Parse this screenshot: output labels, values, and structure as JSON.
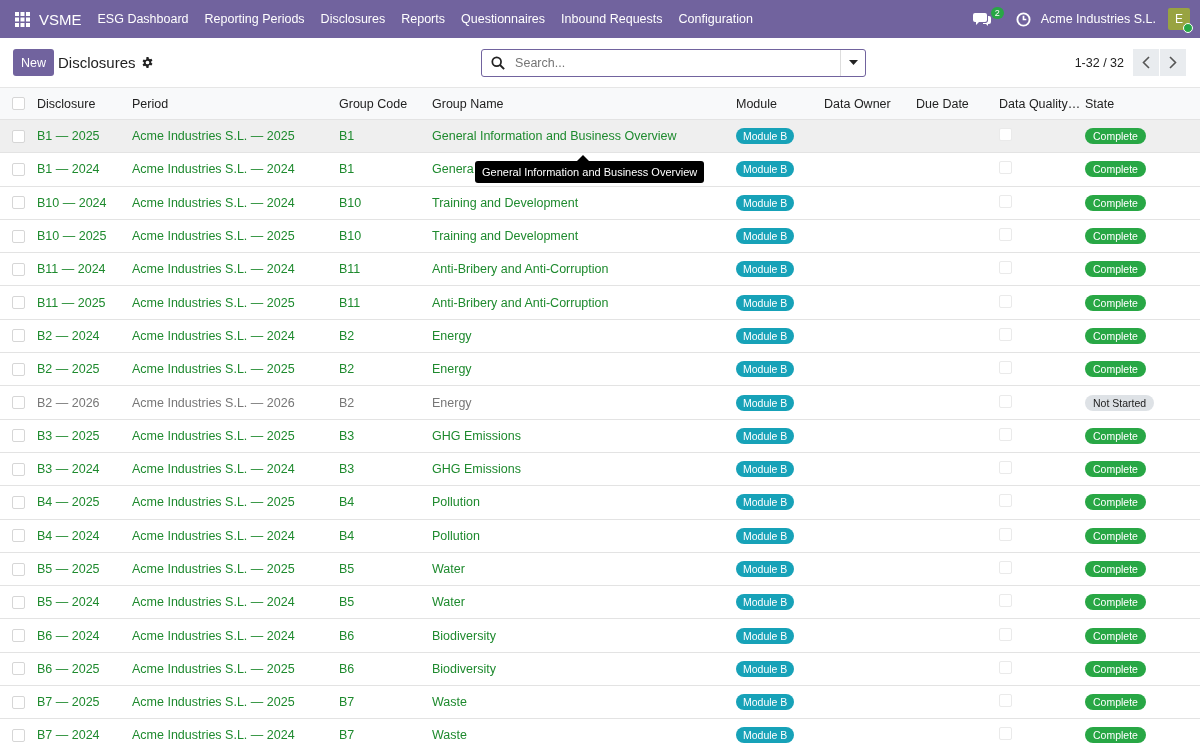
{
  "navbar": {
    "app_name": "VSME",
    "menu": [
      "ESG Dashboard",
      "Reporting Periods",
      "Disclosures",
      "Reports",
      "Questionnaires",
      "Inbound Requests",
      "Configuration"
    ],
    "messages_count": "2",
    "company": "Acme Industries S.L.",
    "avatar_letter": "E",
    "online": true
  },
  "control_panel": {
    "new_button": "New",
    "title": "Disclosures",
    "search": {
      "placeholder": "Search..."
    },
    "pager": "1-32 / 32"
  },
  "table": {
    "select_all": false,
    "columns": [
      "Disclosure",
      "Period",
      "Group Code",
      "Group Name",
      "Module",
      "Data Owner",
      "Due Date",
      "Data Quality…",
      "State"
    ],
    "rows": [
      {
        "disclosure": "B1 — 2025",
        "period": "Acme Industries S.L. — 2025",
        "group_code": "B1",
        "group_name": "General Information and Business Overview",
        "module": "Module B",
        "data_quality": false,
        "state": "Complete",
        "kind": "complete",
        "selected": false,
        "hovered": true
      },
      {
        "disclosure": "B1 — 2024",
        "period": "Acme Industries S.L. — 2024",
        "group_code": "B1",
        "group_name": "Genera",
        "module": "Module B",
        "data_quality": false,
        "state": "Complete",
        "kind": "complete",
        "selected": false,
        "hovered": false
      },
      {
        "disclosure": "B10 — 2024",
        "period": "Acme Industries S.L. — 2024",
        "group_code": "B10",
        "group_name": "Training and Development",
        "module": "Module B",
        "data_quality": false,
        "state": "Complete",
        "kind": "complete",
        "selected": false,
        "hovered": false
      },
      {
        "disclosure": "B10 — 2025",
        "period": "Acme Industries S.L. — 2025",
        "group_code": "B10",
        "group_name": "Training and Development",
        "module": "Module B",
        "data_quality": false,
        "state": "Complete",
        "kind": "complete",
        "selected": false,
        "hovered": false
      },
      {
        "disclosure": "B11 — 2024",
        "period": "Acme Industries S.L. — 2024",
        "group_code": "B11",
        "group_name": "Anti-Bribery and Anti-Corruption",
        "module": "Module B",
        "data_quality": false,
        "state": "Complete",
        "kind": "complete",
        "selected": false,
        "hovered": false
      },
      {
        "disclosure": "B11 — 2025",
        "period": "Acme Industries S.L. — 2025",
        "group_code": "B11",
        "group_name": "Anti-Bribery and Anti-Corruption",
        "module": "Module B",
        "data_quality": false,
        "state": "Complete",
        "kind": "complete",
        "selected": false,
        "hovered": false
      },
      {
        "disclosure": "B2 — 2024",
        "period": "Acme Industries S.L. — 2024",
        "group_code": "B2",
        "group_name": "Energy",
        "module": "Module B",
        "data_quality": false,
        "state": "Complete",
        "kind": "complete",
        "selected": false,
        "hovered": false
      },
      {
        "disclosure": "B2 — 2025",
        "period": "Acme Industries S.L. — 2025",
        "group_code": "B2",
        "group_name": "Energy",
        "module": "Module B",
        "data_quality": false,
        "state": "Complete",
        "kind": "complete",
        "selected": false,
        "hovered": false
      },
      {
        "disclosure": "B2 — 2026",
        "period": "Acme Industries S.L. — 2026",
        "group_code": "B2",
        "group_name": "Energy",
        "module": "Module B",
        "data_quality": false,
        "state": "Not Started",
        "kind": "not_started",
        "selected": false,
        "hovered": false
      },
      {
        "disclosure": "B3 — 2025",
        "period": "Acme Industries S.L. — 2025",
        "group_code": "B3",
        "group_name": "GHG Emissions",
        "module": "Module B",
        "data_quality": false,
        "state": "Complete",
        "kind": "complete",
        "selected": false,
        "hovered": false
      },
      {
        "disclosure": "B3 — 2024",
        "period": "Acme Industries S.L. — 2024",
        "group_code": "B3",
        "group_name": "GHG Emissions",
        "module": "Module B",
        "data_quality": false,
        "state": "Complete",
        "kind": "complete",
        "selected": false,
        "hovered": false
      },
      {
        "disclosure": "B4 — 2025",
        "period": "Acme Industries S.L. — 2025",
        "group_code": "B4",
        "group_name": "Pollution",
        "module": "Module B",
        "data_quality": false,
        "state": "Complete",
        "kind": "complete",
        "selected": false,
        "hovered": false
      },
      {
        "disclosure": "B4 — 2024",
        "period": "Acme Industries S.L. — 2024",
        "group_code": "B4",
        "group_name": "Pollution",
        "module": "Module B",
        "data_quality": false,
        "state": "Complete",
        "kind": "complete",
        "selected": false,
        "hovered": false
      },
      {
        "disclosure": "B5 — 2025",
        "period": "Acme Industries S.L. — 2025",
        "group_code": "B5",
        "group_name": "Water",
        "module": "Module B",
        "data_quality": false,
        "state": "Complete",
        "kind": "complete",
        "selected": false,
        "hovered": false
      },
      {
        "disclosure": "B5 — 2024",
        "period": "Acme Industries S.L. — 2024",
        "group_code": "B5",
        "group_name": "Water",
        "module": "Module B",
        "data_quality": false,
        "state": "Complete",
        "kind": "complete",
        "selected": false,
        "hovered": false
      },
      {
        "disclosure": "B6 — 2024",
        "period": "Acme Industries S.L. — 2024",
        "group_code": "B6",
        "group_name": "Biodiversity",
        "module": "Module B",
        "data_quality": false,
        "state": "Complete",
        "kind": "complete",
        "selected": false,
        "hovered": false
      },
      {
        "disclosure": "B6 — 2025",
        "period": "Acme Industries S.L. — 2025",
        "group_code": "B6",
        "group_name": "Biodiversity",
        "module": "Module B",
        "data_quality": false,
        "state": "Complete",
        "kind": "complete",
        "selected": false,
        "hovered": false
      },
      {
        "disclosure": "B7 — 2025",
        "period": "Acme Industries S.L. — 2025",
        "group_code": "B7",
        "group_name": "Waste",
        "module": "Module B",
        "data_quality": false,
        "state": "Complete",
        "kind": "complete",
        "selected": false,
        "hovered": false
      },
      {
        "disclosure": "B7 — 2024",
        "period": "Acme Industries S.L. — 2024",
        "group_code": "B7",
        "group_name": "Waste",
        "module": "Module B",
        "data_quality": false,
        "state": "Complete",
        "kind": "complete",
        "selected": false,
        "hovered": false
      }
    ]
  },
  "tooltip": {
    "text": "General Information and Business Overview"
  }
}
